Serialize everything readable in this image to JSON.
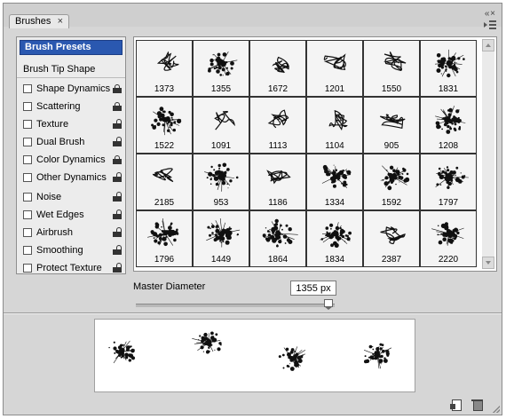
{
  "panel": {
    "tab_label": "Brushes",
    "tab_close_glyph": "×",
    "collapse_glyph": "«  ×"
  },
  "sidebar": {
    "header": "Brush Presets",
    "tip_shape": "Brush Tip Shape",
    "options_group1": [
      {
        "label": "Shape Dynamics",
        "lock": "locked"
      },
      {
        "label": "Scattering",
        "lock": "locked"
      },
      {
        "label": "Texture",
        "lock": "unlocked"
      },
      {
        "label": "Dual Brush",
        "lock": "unlocked"
      },
      {
        "label": "Color Dynamics",
        "lock": "locked"
      },
      {
        "label": "Other Dynamics",
        "lock": "unlocked"
      }
    ],
    "options_group2": [
      {
        "label": "Noise",
        "lock": "unlocked"
      },
      {
        "label": "Wet Edges",
        "lock": "unlocked"
      },
      {
        "label": "Airbrush",
        "lock": "unlocked"
      },
      {
        "label": "Smoothing",
        "lock": "unlocked"
      },
      {
        "label": "Protect Texture",
        "lock": "unlocked"
      }
    ]
  },
  "presets": [
    {
      "size": "1373",
      "style": "scribble"
    },
    {
      "size": "1355",
      "style": "splatter"
    },
    {
      "size": "1672",
      "style": "scribble"
    },
    {
      "size": "1201",
      "style": "scribble"
    },
    {
      "size": "1550",
      "style": "scribble"
    },
    {
      "size": "1831",
      "style": "splatter"
    },
    {
      "size": "1522",
      "style": "splatter"
    },
    {
      "size": "1091",
      "style": "scribble"
    },
    {
      "size": "1113",
      "style": "scribble"
    },
    {
      "size": "1104",
      "style": "scribble"
    },
    {
      "size": "905",
      "style": "scribble"
    },
    {
      "size": "1208",
      "style": "splatter"
    },
    {
      "size": "2185",
      "style": "scribble"
    },
    {
      "size": "953",
      "style": "splatter"
    },
    {
      "size": "1186",
      "style": "scribble"
    },
    {
      "size": "1334",
      "style": "splatter"
    },
    {
      "size": "1592",
      "style": "splatter"
    },
    {
      "size": "1797",
      "style": "splatter"
    },
    {
      "size": "1796",
      "style": "splatter"
    },
    {
      "size": "1449",
      "style": "splatter"
    },
    {
      "size": "1864",
      "style": "splatter"
    },
    {
      "size": "1834",
      "style": "splatter"
    },
    {
      "size": "2387",
      "style": "scribble"
    },
    {
      "size": "2220",
      "style": "splatter"
    }
  ],
  "master_diameter": {
    "label": "Master Diameter",
    "value": "1355 px",
    "slider_fraction": 0.97
  },
  "colors": {
    "selection": "#2a58b0",
    "panel_bg": "#d6d6d6",
    "ink": "#111111"
  },
  "icons": [
    "close-icon",
    "collapse-icon",
    "panel-menu-icon",
    "lock-icon",
    "new-brush-icon",
    "trash-icon"
  ]
}
